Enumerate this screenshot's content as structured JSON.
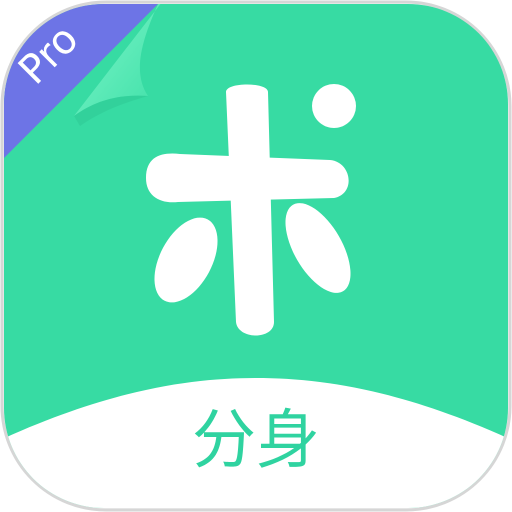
{
  "icon": {
    "badge_text": "Pro",
    "app_label": "分身",
    "glyph": "plant-sprout-glyph"
  },
  "colors": {
    "background": "#ffffff",
    "frame_border": "#d6d6d6",
    "frame_fill": "#f4f4f4",
    "icon_main": "#37dba3",
    "badge": "#6d74e6",
    "page_curl": "#5cefb9",
    "page_curl_shadow": "#2cc08d",
    "glyph": "#ffffff",
    "label_bg": "#ffffff",
    "label_text": "#2fd3a0",
    "badge_text": "#ffffff"
  }
}
